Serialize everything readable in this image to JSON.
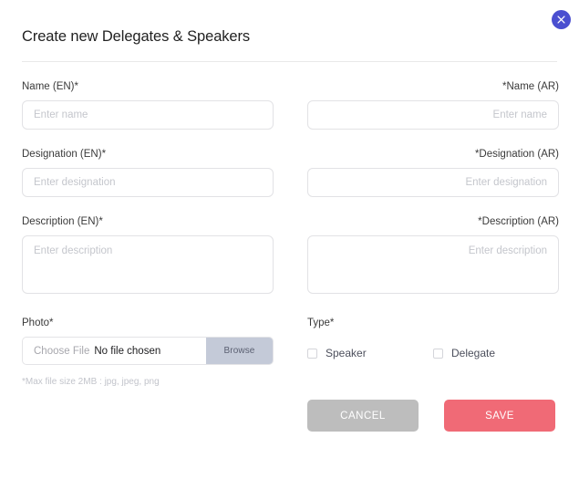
{
  "dialog": {
    "title": "Create new Delegates & Speakers",
    "close_icon": "close-icon"
  },
  "fields": {
    "name_en": {
      "label": "Name (EN)*",
      "placeholder": "Enter name",
      "value": ""
    },
    "name_ar": {
      "label": "*Name (AR)",
      "placeholder": "Enter name",
      "value": ""
    },
    "designation_en": {
      "label": "Designation (EN)*",
      "placeholder": "Enter designation",
      "value": ""
    },
    "designation_ar": {
      "label": "*Designation (AR)",
      "placeholder": "Enter designation",
      "value": ""
    },
    "description_en": {
      "label": "Description (EN)*",
      "placeholder": "Enter description",
      "value": ""
    },
    "description_ar": {
      "label": "*Description (AR)",
      "placeholder": "Enter description",
      "value": ""
    }
  },
  "photo": {
    "label": "Photo*",
    "choose_text": "Choose File",
    "file_name": "No file chosen",
    "browse_label": "Browse",
    "hint": "*Max file size 2MB : jpg, jpeg, png"
  },
  "type": {
    "label": "Type*",
    "options": [
      {
        "label": "Speaker",
        "checked": false
      },
      {
        "label": "Delegate",
        "checked": false
      }
    ]
  },
  "actions": {
    "cancel_label": "CANCEL",
    "save_label": "SAVE"
  },
  "colors": {
    "close_button": "#4a4fd0",
    "save_button": "#f06a76",
    "cancel_button": "#bdbdbd",
    "browse_button": "#c4cad8",
    "input_border": "#e2e2e5",
    "placeholder": "#c4c6cc",
    "hint_text": "#c2c4cb"
  }
}
